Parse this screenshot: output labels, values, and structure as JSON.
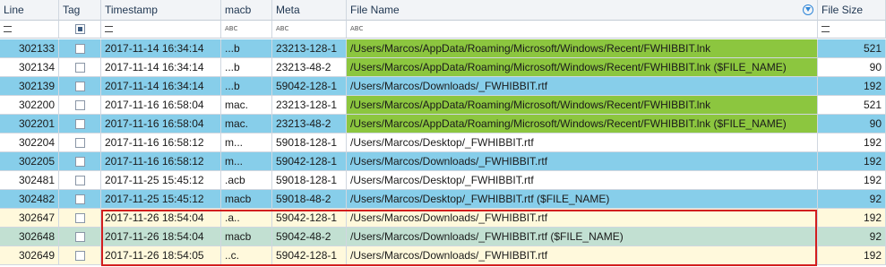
{
  "columns": {
    "line": "Line",
    "tag": "Tag",
    "timestamp": "Timestamp",
    "macb": "macb",
    "meta": "Meta",
    "file_name": "File Name",
    "file_size": "File Size"
  },
  "filter_icons": {
    "line": "equals-icon",
    "tag": "checkbox-icon",
    "timestamp": "equals-icon",
    "macb": "abc-text-icon",
    "meta": "abc-text-icon",
    "file_name": "abc-text-icon",
    "file_size": "equals-icon"
  },
  "abc_text": "ABC",
  "colors": {
    "row_blue": "#87ceea",
    "row_white": "#ffffff",
    "row_cream": "#fff9dc",
    "row_mint": "#c2e0d2",
    "file_highlight_green": "#8cc63f",
    "selection_border": "#d21e1e"
  },
  "rows": [
    {
      "line": "302133",
      "timestamp": "2017-11-14 16:34:14",
      "macb": "...b",
      "meta": "23213-128-1",
      "file_name": "/Users/Marcos/AppData/Roaming/Microsoft/Windows/Recent/FWHIBBIT.lnk",
      "file_size": "521",
      "row_color": "blue",
      "file_highlight": true
    },
    {
      "line": "302134",
      "timestamp": "2017-11-14 16:34:14",
      "macb": "...b",
      "meta": "23213-48-2",
      "file_name": "/Users/Marcos/AppData/Roaming/Microsoft/Windows/Recent/FWHIBBIT.lnk ($FILE_NAME)",
      "file_size": "90",
      "row_color": "white",
      "file_highlight": true
    },
    {
      "line": "302139",
      "timestamp": "2017-11-14 16:34:14",
      "macb": "...b",
      "meta": "59042-128-1",
      "file_name": "/Users/Marcos/Downloads/_FWHIBBIT.rtf",
      "file_size": "192",
      "row_color": "blue",
      "file_highlight": false
    },
    {
      "line": "302200",
      "timestamp": "2017-11-16 16:58:04",
      "macb": "mac.",
      "meta": "23213-128-1",
      "file_name": "/Users/Marcos/AppData/Roaming/Microsoft/Windows/Recent/FWHIBBIT.lnk",
      "file_size": "521",
      "row_color": "white",
      "file_highlight": true
    },
    {
      "line": "302201",
      "timestamp": "2017-11-16 16:58:04",
      "macb": "mac.",
      "meta": "23213-48-2",
      "file_name": "/Users/Marcos/AppData/Roaming/Microsoft/Windows/Recent/FWHIBBIT.lnk ($FILE_NAME)",
      "file_size": "90",
      "row_color": "blue",
      "file_highlight": true
    },
    {
      "line": "302204",
      "timestamp": "2017-11-16 16:58:12",
      "macb": "m...",
      "meta": "59018-128-1",
      "file_name": "/Users/Marcos/Desktop/_FWHIBBIT.rtf",
      "file_size": "192",
      "row_color": "white",
      "file_highlight": false
    },
    {
      "line": "302205",
      "timestamp": "2017-11-16 16:58:12",
      "macb": "m...",
      "meta": "59042-128-1",
      "file_name": "/Users/Marcos/Downloads/_FWHIBBIT.rtf",
      "file_size": "192",
      "row_color": "blue",
      "file_highlight": false
    },
    {
      "line": "302481",
      "timestamp": "2017-11-25 15:45:12",
      "macb": ".acb",
      "meta": "59018-128-1",
      "file_name": "/Users/Marcos/Desktop/_FWHIBBIT.rtf",
      "file_size": "192",
      "row_color": "white",
      "file_highlight": false
    },
    {
      "line": "302482",
      "timestamp": "2017-11-25 15:45:12",
      "macb": "macb",
      "meta": "59018-48-2",
      "file_name": "/Users/Marcos/Desktop/_FWHIBBIT.rtf ($FILE_NAME)",
      "file_size": "92",
      "row_color": "blue",
      "file_highlight": false
    },
    {
      "line": "302647",
      "timestamp": "2017-11-26 18:54:04",
      "macb": ".a..",
      "meta": "59042-128-1",
      "file_name": "/Users/Marcos/Downloads/_FWHIBBIT.rtf",
      "file_size": "192",
      "row_color": "cream",
      "file_highlight": false
    },
    {
      "line": "302648",
      "timestamp": "2017-11-26 18:54:04",
      "macb": "macb",
      "meta": "59042-48-2",
      "file_name": "/Users/Marcos/Downloads/_FWHIBBIT.rtf ($FILE_NAME)",
      "file_size": "92",
      "row_color": "mint",
      "file_highlight": false
    },
    {
      "line": "302649",
      "timestamp": "2017-11-26 18:54:05",
      "macb": "..c.",
      "meta": "59042-128-1",
      "file_name": "/Users/Marcos/Downloads/_FWHIBBIT.rtf",
      "file_size": "192",
      "row_color": "cream",
      "file_highlight": false
    }
  ]
}
